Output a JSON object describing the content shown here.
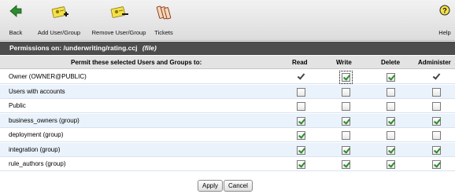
{
  "toolbar": {
    "back_label": "Back",
    "add_label": "Add User/Group",
    "remove_label": "Remove User/Group",
    "tickets_label": "Tickets",
    "help_label": "Help"
  },
  "header": {
    "title": "Permissions on: /underwriting/rating.ccj",
    "note": "(file)"
  },
  "columns": {
    "permit": "Permit these selected Users and Groups to:",
    "read": "Read",
    "write": "Write",
    "delete": "Delete",
    "administer": "Administer"
  },
  "rows": [
    {
      "name": "Owner (OWNER@PUBLIC)",
      "read": "tick",
      "write": "checked-focus",
      "delete": "checked",
      "administer": "tick"
    },
    {
      "name": "Users with accounts",
      "read": "unchecked",
      "write": "unchecked",
      "delete": "unchecked",
      "administer": "unchecked"
    },
    {
      "name": "Public",
      "read": "unchecked",
      "write": "unchecked",
      "delete": "unchecked",
      "administer": "unchecked"
    },
    {
      "name": "business_owners (group)",
      "read": "checked",
      "write": "checked",
      "delete": "checked",
      "administer": "checked"
    },
    {
      "name": "deployment (group)",
      "read": "checked",
      "write": "unchecked",
      "delete": "unchecked",
      "administer": "unchecked"
    },
    {
      "name": "integration (group)",
      "read": "checked",
      "write": "checked",
      "delete": "checked",
      "administer": "checked"
    },
    {
      "name": "rule_authors (group)",
      "read": "checked",
      "write": "checked",
      "delete": "checked",
      "administer": "checked"
    }
  ],
  "actions": {
    "apply_label": "Apply",
    "cancel_label": "Cancel"
  },
  "colors": {
    "header_bg": "#4d4d4d",
    "row_alt_bg": "#eaf2fb",
    "check_green": "#2f8a2f"
  }
}
